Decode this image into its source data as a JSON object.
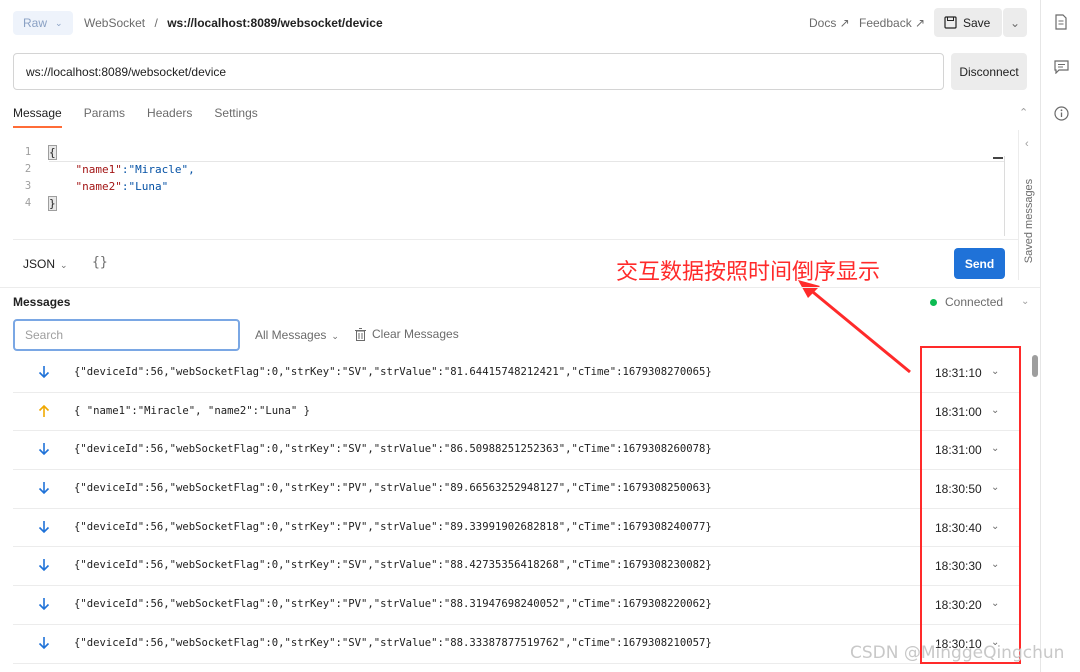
{
  "header": {
    "mode_label": "Raw",
    "breadcrumb_parent": "WebSocket",
    "breadcrumb_sep": "/",
    "breadcrumb_title": "ws://localhost:8089/websocket/device",
    "docs_label": "Docs ↗",
    "feedback_label": "Feedback ↗",
    "save_label": "Save"
  },
  "request": {
    "url": "ws://localhost:8089/websocket/device",
    "disconnect_label": "Disconnect"
  },
  "tabs": [
    {
      "label": "Message"
    },
    {
      "label": "Params"
    },
    {
      "label": "Headers"
    },
    {
      "label": "Settings"
    }
  ],
  "editor": {
    "line_numbers": [
      "1",
      "2",
      "3",
      "4"
    ],
    "line1": "{",
    "line2_key": "\"name1\"",
    "line2_rest": ":\"Miracle\",",
    "line3_key": "\"name2\"",
    "line3_rest": ":\"Luna\"",
    "line4": "}"
  },
  "composer": {
    "format_label": "JSON",
    "beautify_label": "{}",
    "send_label": "Send",
    "saved_messages_label": "Saved messages"
  },
  "annotation": {
    "text": "交互数据按照时间倒序显示",
    "color": "#ff2a2a"
  },
  "messages": {
    "title": "Messages",
    "status": "Connected",
    "status_color": "#0cbb52",
    "search_placeholder": "Search",
    "filter_label": "All Messages",
    "clear_label": "Clear Messages",
    "rows": [
      {
        "direction": "incoming",
        "payload": "{\"deviceId\":56,\"webSocketFlag\":0,\"strKey\":\"SV\",\"strValue\":\"81.64415748212421\",\"cTime\":1679308270065}",
        "time": "18:31:10"
      },
      {
        "direction": "outgoing",
        "payload": "{ \"name1\":\"Miracle\", \"name2\":\"Luna\" }",
        "time": "18:31:00"
      },
      {
        "direction": "incoming",
        "payload": "{\"deviceId\":56,\"webSocketFlag\":0,\"strKey\":\"SV\",\"strValue\":\"86.50988251252363\",\"cTime\":1679308260078}",
        "time": "18:31:00"
      },
      {
        "direction": "incoming",
        "payload": "{\"deviceId\":56,\"webSocketFlag\":0,\"strKey\":\"PV\",\"strValue\":\"89.66563252948127\",\"cTime\":1679308250063}",
        "time": "18:30:50"
      },
      {
        "direction": "incoming",
        "payload": "{\"deviceId\":56,\"webSocketFlag\":0,\"strKey\":\"PV\",\"strValue\":\"89.33991902682818\",\"cTime\":1679308240077}",
        "time": "18:30:40"
      },
      {
        "direction": "incoming",
        "payload": "{\"deviceId\":56,\"webSocketFlag\":0,\"strKey\":\"SV\",\"strValue\":\"88.42735356418268\",\"cTime\":1679308230082}",
        "time": "18:30:30"
      },
      {
        "direction": "incoming",
        "payload": "{\"deviceId\":56,\"webSocketFlag\":0,\"strKey\":\"PV\",\"strValue\":\"88.31947698240052\",\"cTime\":1679308220062}",
        "time": "18:30:20"
      },
      {
        "direction": "incoming",
        "payload": "{\"deviceId\":56,\"webSocketFlag\":0,\"strKey\":\"SV\",\"strValue\":\"88.33387877519762\",\"cTime\":1679308210057}",
        "time": "18:30:10"
      }
    ]
  },
  "watermark": "CSDN @MinggeQingchun",
  "colors": {
    "accent_tab": "#ff6c37",
    "send_button": "#1f72d8",
    "incoming_arrow": "#1f72d8",
    "outgoing_arrow": "#f0a800"
  }
}
